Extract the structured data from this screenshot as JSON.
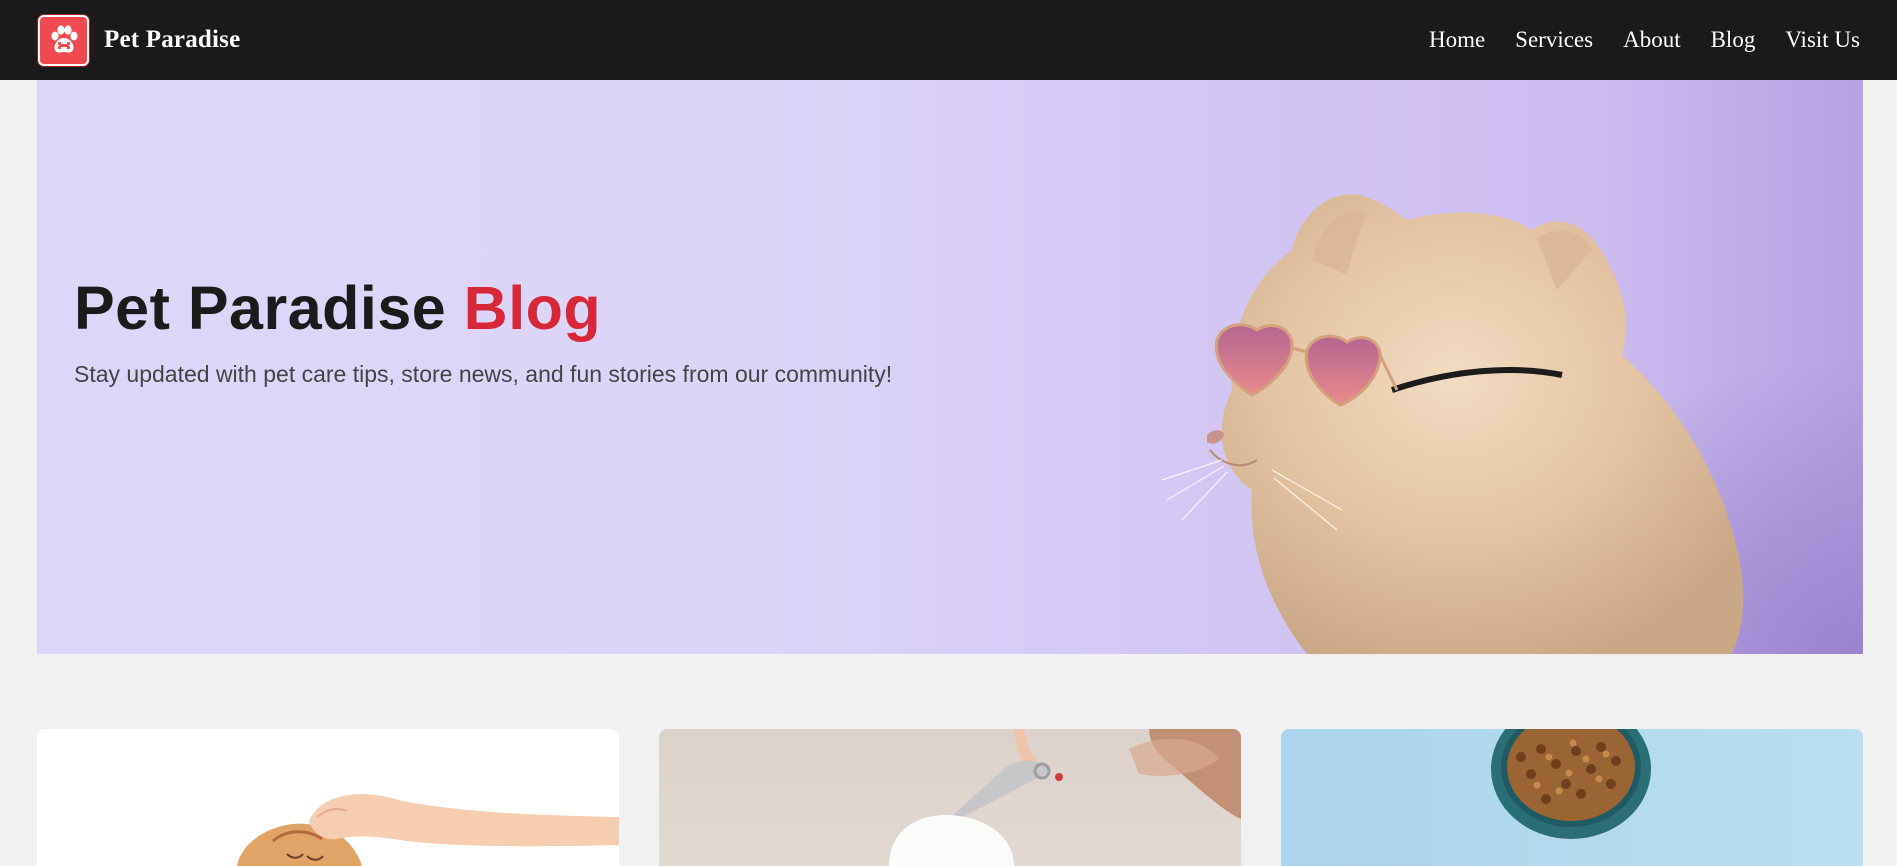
{
  "brand": {
    "name": "Pet Paradise"
  },
  "nav": {
    "items": [
      "Home",
      "Services",
      "About",
      "Blog",
      "Visit Us"
    ]
  },
  "hero": {
    "title_main": "Pet Paradise",
    "title_accent": "Blog",
    "subtitle": "Stay updated with pet care tips, store news, and fun stories from our community!"
  },
  "colors": {
    "nav_bg": "#1a1a1a",
    "accent": "#d7283a",
    "hero_bg": "#ddd5f8",
    "page_bg": "#f1f1f1"
  },
  "cards": [
    {
      "image": "hand-petting-cat-photo"
    },
    {
      "image": "grooming-scissors-dog-photo"
    },
    {
      "image": "pet-food-bowl-photo"
    }
  ]
}
